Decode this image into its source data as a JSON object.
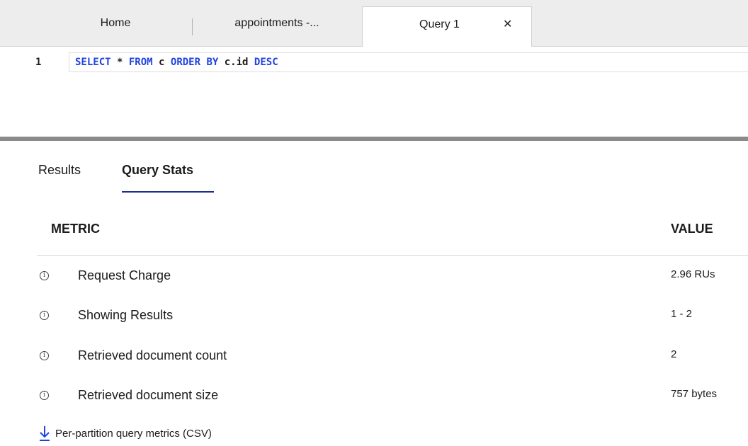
{
  "tabs": {
    "home": "Home",
    "appointments": "appointments -...",
    "query": "Query 1",
    "close_glyph": "✕"
  },
  "editor": {
    "line_number": "1",
    "query_parts": [
      "SELECT",
      " * ",
      "FROM",
      " c ",
      "ORDER BY",
      " c.id ",
      "DESC"
    ]
  },
  "result_tabs": {
    "results": "Results",
    "query_stats": "Query Stats"
  },
  "stats": {
    "header_metric": "METRIC",
    "header_value": "VALUE",
    "rows": [
      {
        "metric": "Request Charge",
        "value": "2.96 RUs"
      },
      {
        "metric": "Showing Results",
        "value": "1 - 2"
      },
      {
        "metric": "Retrieved document count",
        "value": "2"
      },
      {
        "metric": "Retrieved document size",
        "value": "757 bytes"
      }
    ]
  },
  "download": {
    "label": "Per-partition query metrics (CSV)",
    "icon": "download-arrow-icon"
  },
  "colors": {
    "keyword": "#1f43e0",
    "tab_underline": "#1f2f8f"
  }
}
